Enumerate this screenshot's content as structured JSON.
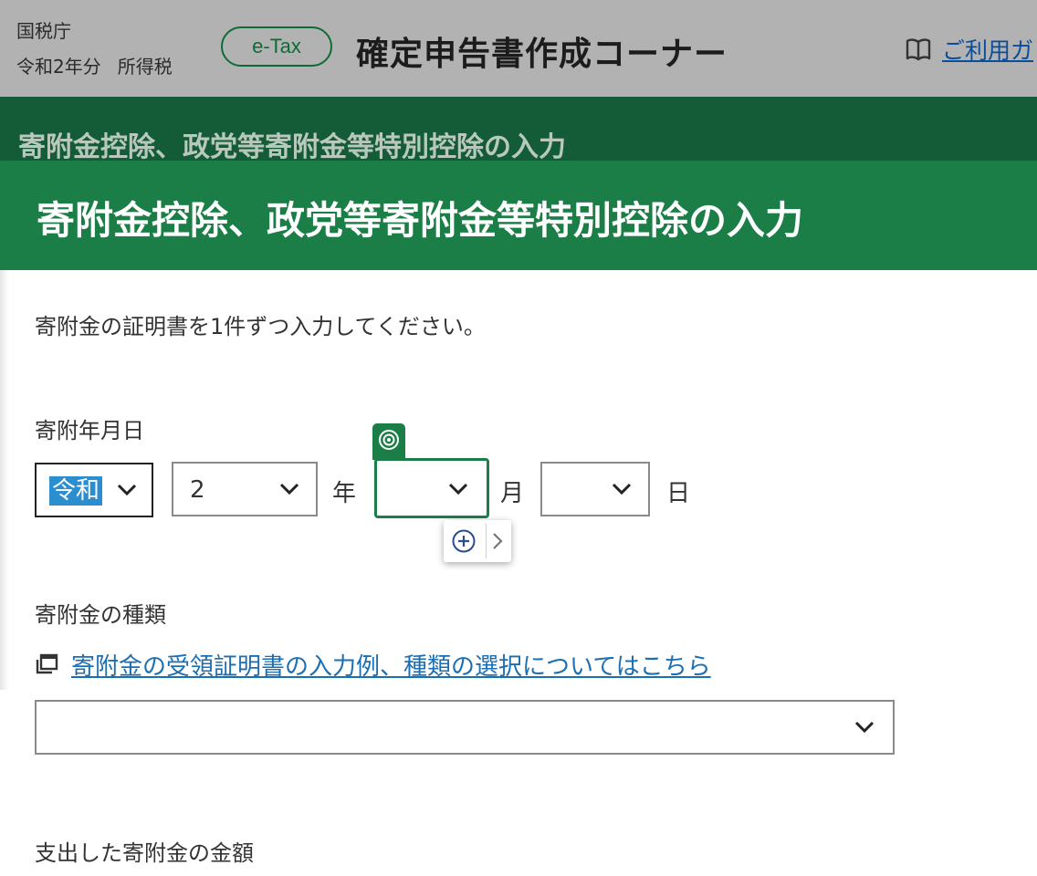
{
  "header": {
    "agency": "国税庁",
    "year": "令和2年分",
    "tax_type": "所得税",
    "etax_badge": "e-Tax",
    "corner_title": "確定申告書作成コーナー",
    "guide_link": "ご利用ガ",
    "guide_icon": "book-icon"
  },
  "page": {
    "title_previous": "寄附金控除、政党等寄附金等特別控除の入力",
    "title": "寄附金控除、政党等寄附金等特別控除の入力",
    "instruction": "寄附金の証明書を1件ずつ入力してください。"
  },
  "donation_date": {
    "label": "寄附年月日",
    "era": "令和",
    "year": "2",
    "year_unit": "年",
    "month": "",
    "month_unit": "月",
    "day": "",
    "day_unit": "日"
  },
  "donation_type": {
    "label": "寄附金の種類",
    "help_link": "寄附金の受領証明書の入力例、種類の選択についてはこちら",
    "selected": ""
  },
  "donation_amount": {
    "label": "支出した寄附金の金額"
  },
  "colors": {
    "header_bg": "#b2b2b2",
    "title_bar_dark": "#145c38",
    "title_bar": "#1c7e47",
    "link": "#1a6fb4",
    "selection": "#2d8ecf"
  }
}
